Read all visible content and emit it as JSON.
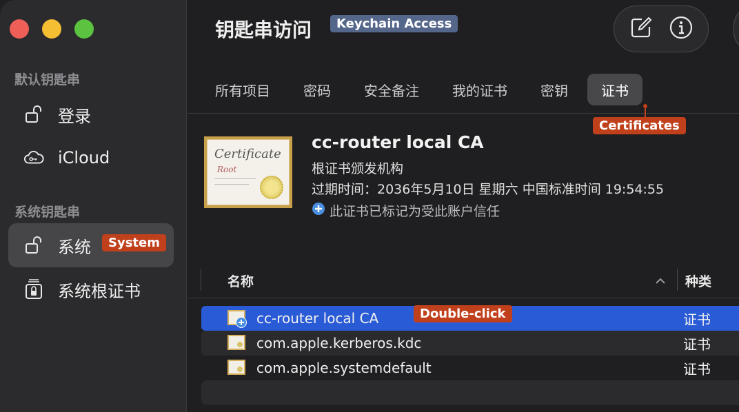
{
  "sidebar": {
    "default_keychains_title": "默认钥匙串",
    "system_keychains_title": "系统钥匙串",
    "items": [
      {
        "label": "登录",
        "icon": "lock-open-icon"
      },
      {
        "label": "iCloud",
        "icon": "cloud-key-icon"
      },
      {
        "label": "系统",
        "icon": "lock-open-icon"
      },
      {
        "label": "系统根证书",
        "icon": "lock-cabinet-icon"
      }
    ],
    "system_callout": "System"
  },
  "header": {
    "title": "钥匙串访问",
    "callout": "Keychain Access",
    "toolbar": [
      "compose-icon",
      "info-icon"
    ]
  },
  "tabs": [
    {
      "label": "所有项目"
    },
    {
      "label": "密码"
    },
    {
      "label": "安全备注"
    },
    {
      "label": "我的证书"
    },
    {
      "label": "密钥"
    },
    {
      "label": "证书"
    }
  ],
  "tabs_callout": "Certificates",
  "detail": {
    "name": "cc-router local CA",
    "subtitle": "根证书颁发机构",
    "expiry": "过期时间：2036年5月10日 星期六 中国标准时间 19:54:55",
    "trust": "此证书已标记为受此账户信任",
    "image_text_1": "Certificate",
    "image_text_2": "Root"
  },
  "list": {
    "col_name": "名称",
    "col_kind": "种类",
    "rows": [
      {
        "name": "cc-router local CA",
        "kind": "证书"
      },
      {
        "name": "com.apple.kerberos.kdc",
        "kind": "证书"
      },
      {
        "name": "com.apple.systemdefault",
        "kind": "证书"
      }
    ],
    "row_callout": "Double-click"
  },
  "colors": {
    "selection": "#2a5bd7",
    "callout": "#c0401c",
    "callout_blue": "#54668a"
  }
}
